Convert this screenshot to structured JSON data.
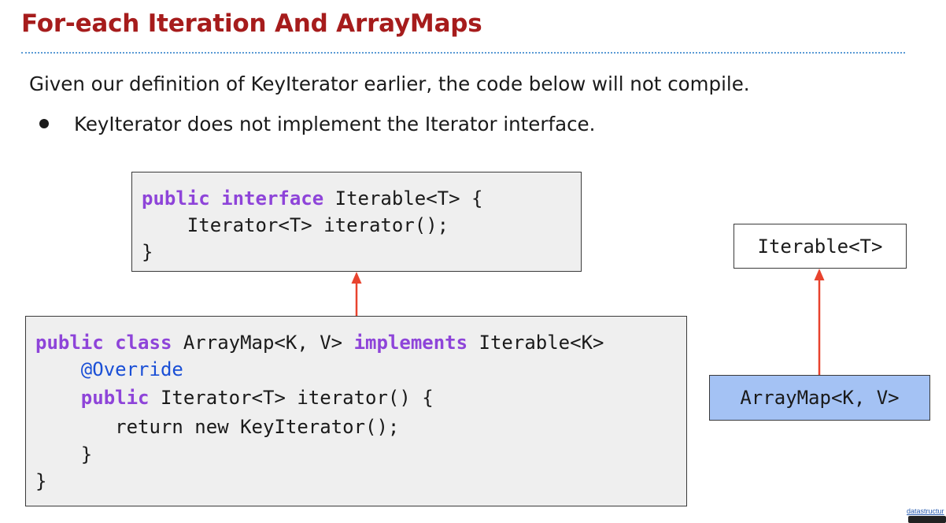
{
  "title": "For-each Iteration And ArrayMaps",
  "body_text": "Given our definition of KeyIterator earlier, the code below will not compile.",
  "bullet": "KeyIterator does not implement the Iterator interface.",
  "interface_code": {
    "line1_kw": "public interface",
    "line1_rest": " Iterable<T> {",
    "line2": "    Iterator<T> iterator();",
    "line3": "}"
  },
  "class_code": {
    "line1_kw1": "public class",
    "line1_mid": " ArrayMap<K, V> ",
    "line1_kw2": "implements",
    "line1_rest": " Iterable<K>",
    "line2_indent": "    ",
    "line2_anno": "@Override",
    "line3_indent": "    ",
    "line3_kw": "public",
    "line3_rest": " Iterator<T> iterator() {",
    "line4": "       return new KeyIterator();",
    "line5": "    }",
    "line6": "}"
  },
  "uml": {
    "parent_label": "Iterable<T>",
    "child_label": "ArrayMap<K, V>"
  },
  "license_text": "datastructur",
  "colors": {
    "title": "#a61c1c",
    "rule": "#5b9bd5",
    "keyword": "#8e44d9",
    "annotation": "#1a4fd6",
    "arrow": "#e8432e",
    "code_bg": "#efefef",
    "child_box_bg": "#a4c2f4"
  }
}
